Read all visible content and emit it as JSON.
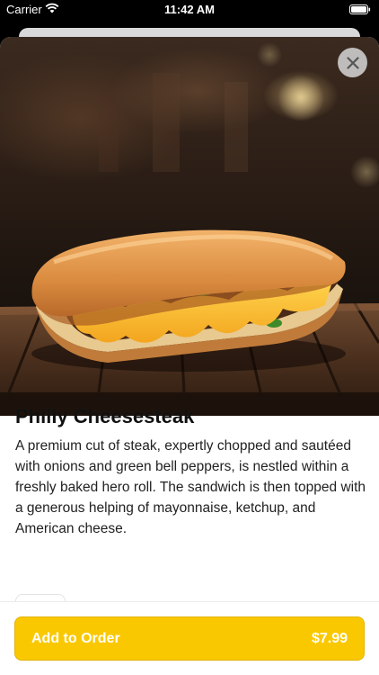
{
  "status": {
    "carrier": "Carrier",
    "time": "11:42 AM",
    "wifi_icon": "wifi-icon",
    "battery_icon": "battery-icon"
  },
  "item": {
    "name": "Philly Cheesesteak",
    "description": "A premium cut of steak, expertly chopped and sautéed with onions and green bell peppers, is nestled within a freshly baked hero roll. The sandwich is then topped with a generous helping of mayonnaise, ketchup, and American cheese.",
    "image_icon": "sandwich-photo"
  },
  "actions": {
    "close_icon": "close-icon",
    "add_to_order_label": "Add to Order",
    "price": "$7.99"
  },
  "colors": {
    "accent": "#fac800",
    "text": "#111111"
  }
}
